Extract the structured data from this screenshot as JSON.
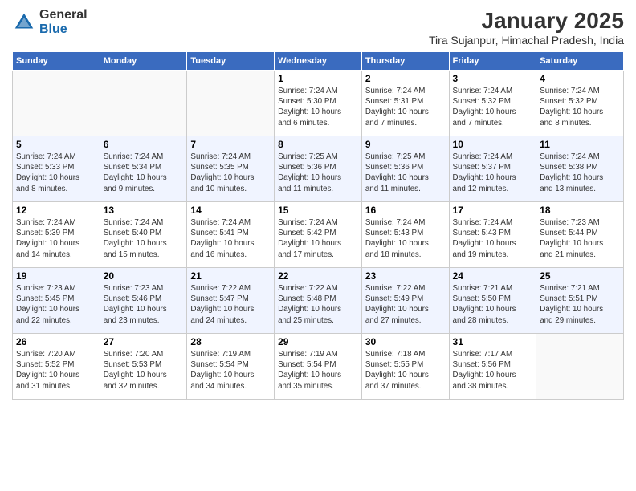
{
  "logo": {
    "general": "General",
    "blue": "Blue"
  },
  "title": "January 2025",
  "location": "Tira Sujanpur, Himachal Pradesh, India",
  "days_header": [
    "Sunday",
    "Monday",
    "Tuesday",
    "Wednesday",
    "Thursday",
    "Friday",
    "Saturday"
  ],
  "weeks": [
    [
      {
        "num": "",
        "info": ""
      },
      {
        "num": "",
        "info": ""
      },
      {
        "num": "",
        "info": ""
      },
      {
        "num": "1",
        "info": "Sunrise: 7:24 AM\nSunset: 5:30 PM\nDaylight: 10 hours\nand 6 minutes."
      },
      {
        "num": "2",
        "info": "Sunrise: 7:24 AM\nSunset: 5:31 PM\nDaylight: 10 hours\nand 7 minutes."
      },
      {
        "num": "3",
        "info": "Sunrise: 7:24 AM\nSunset: 5:32 PM\nDaylight: 10 hours\nand 7 minutes."
      },
      {
        "num": "4",
        "info": "Sunrise: 7:24 AM\nSunset: 5:32 PM\nDaylight: 10 hours\nand 8 minutes."
      }
    ],
    [
      {
        "num": "5",
        "info": "Sunrise: 7:24 AM\nSunset: 5:33 PM\nDaylight: 10 hours\nand 8 minutes."
      },
      {
        "num": "6",
        "info": "Sunrise: 7:24 AM\nSunset: 5:34 PM\nDaylight: 10 hours\nand 9 minutes."
      },
      {
        "num": "7",
        "info": "Sunrise: 7:24 AM\nSunset: 5:35 PM\nDaylight: 10 hours\nand 10 minutes."
      },
      {
        "num": "8",
        "info": "Sunrise: 7:25 AM\nSunset: 5:36 PM\nDaylight: 10 hours\nand 11 minutes."
      },
      {
        "num": "9",
        "info": "Sunrise: 7:25 AM\nSunset: 5:36 PM\nDaylight: 10 hours\nand 11 minutes."
      },
      {
        "num": "10",
        "info": "Sunrise: 7:24 AM\nSunset: 5:37 PM\nDaylight: 10 hours\nand 12 minutes."
      },
      {
        "num": "11",
        "info": "Sunrise: 7:24 AM\nSunset: 5:38 PM\nDaylight: 10 hours\nand 13 minutes."
      }
    ],
    [
      {
        "num": "12",
        "info": "Sunrise: 7:24 AM\nSunset: 5:39 PM\nDaylight: 10 hours\nand 14 minutes."
      },
      {
        "num": "13",
        "info": "Sunrise: 7:24 AM\nSunset: 5:40 PM\nDaylight: 10 hours\nand 15 minutes."
      },
      {
        "num": "14",
        "info": "Sunrise: 7:24 AM\nSunset: 5:41 PM\nDaylight: 10 hours\nand 16 minutes."
      },
      {
        "num": "15",
        "info": "Sunrise: 7:24 AM\nSunset: 5:42 PM\nDaylight: 10 hours\nand 17 minutes."
      },
      {
        "num": "16",
        "info": "Sunrise: 7:24 AM\nSunset: 5:43 PM\nDaylight: 10 hours\nand 18 minutes."
      },
      {
        "num": "17",
        "info": "Sunrise: 7:24 AM\nSunset: 5:43 PM\nDaylight: 10 hours\nand 19 minutes."
      },
      {
        "num": "18",
        "info": "Sunrise: 7:23 AM\nSunset: 5:44 PM\nDaylight: 10 hours\nand 21 minutes."
      }
    ],
    [
      {
        "num": "19",
        "info": "Sunrise: 7:23 AM\nSunset: 5:45 PM\nDaylight: 10 hours\nand 22 minutes."
      },
      {
        "num": "20",
        "info": "Sunrise: 7:23 AM\nSunset: 5:46 PM\nDaylight: 10 hours\nand 23 minutes."
      },
      {
        "num": "21",
        "info": "Sunrise: 7:22 AM\nSunset: 5:47 PM\nDaylight: 10 hours\nand 24 minutes."
      },
      {
        "num": "22",
        "info": "Sunrise: 7:22 AM\nSunset: 5:48 PM\nDaylight: 10 hours\nand 25 minutes."
      },
      {
        "num": "23",
        "info": "Sunrise: 7:22 AM\nSunset: 5:49 PM\nDaylight: 10 hours\nand 27 minutes."
      },
      {
        "num": "24",
        "info": "Sunrise: 7:21 AM\nSunset: 5:50 PM\nDaylight: 10 hours\nand 28 minutes."
      },
      {
        "num": "25",
        "info": "Sunrise: 7:21 AM\nSunset: 5:51 PM\nDaylight: 10 hours\nand 29 minutes."
      }
    ],
    [
      {
        "num": "26",
        "info": "Sunrise: 7:20 AM\nSunset: 5:52 PM\nDaylight: 10 hours\nand 31 minutes."
      },
      {
        "num": "27",
        "info": "Sunrise: 7:20 AM\nSunset: 5:53 PM\nDaylight: 10 hours\nand 32 minutes."
      },
      {
        "num": "28",
        "info": "Sunrise: 7:19 AM\nSunset: 5:54 PM\nDaylight: 10 hours\nand 34 minutes."
      },
      {
        "num": "29",
        "info": "Sunrise: 7:19 AM\nSunset: 5:54 PM\nDaylight: 10 hours\nand 35 minutes."
      },
      {
        "num": "30",
        "info": "Sunrise: 7:18 AM\nSunset: 5:55 PM\nDaylight: 10 hours\nand 37 minutes."
      },
      {
        "num": "31",
        "info": "Sunrise: 7:17 AM\nSunset: 5:56 PM\nDaylight: 10 hours\nand 38 minutes."
      },
      {
        "num": "",
        "info": ""
      }
    ]
  ]
}
